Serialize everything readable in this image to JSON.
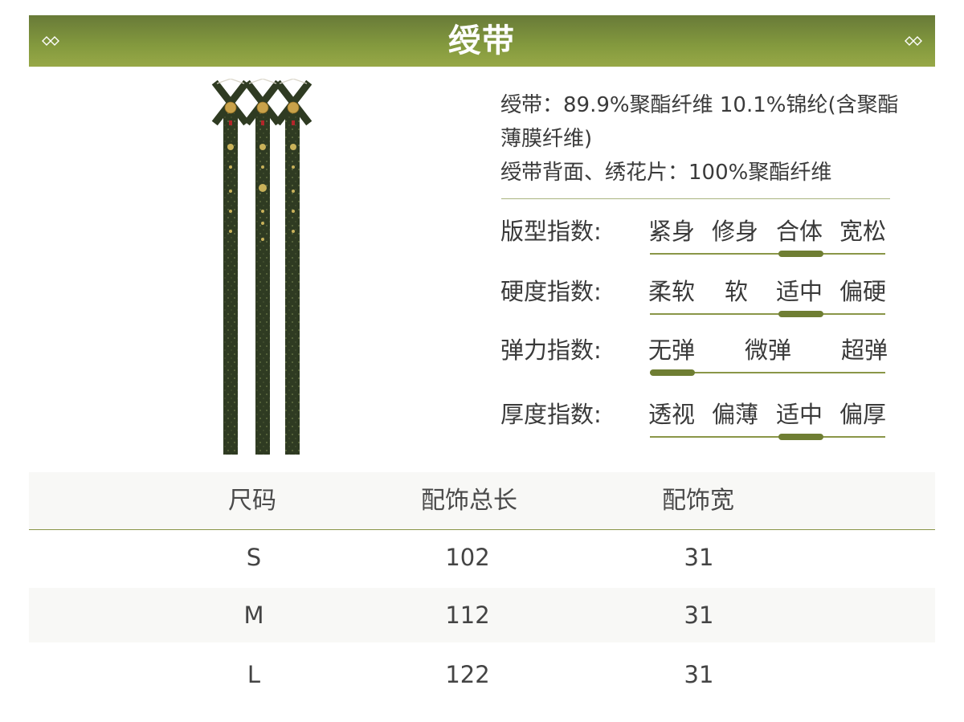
{
  "header": {
    "title": "绶带",
    "ornament_icon": "double-diamond-icon",
    "color": "#849a3e"
  },
  "product": {
    "image_icon": "ribbon-sash-illustration"
  },
  "material": {
    "lines": [
      "绶带：89.9%聚酯纤维 10.1%锦纶(含聚酯",
      "薄膜纤维)",
      "绶带背面、绣花片：100%聚酯纤维"
    ]
  },
  "indices": [
    {
      "label": "版型指数:",
      "options": [
        "紧身",
        "修身",
        "合体",
        "宽松"
      ],
      "selected": 2
    },
    {
      "label": "硬度指数:",
      "options": [
        "柔软",
        "软",
        "适中",
        "偏硬"
      ],
      "selected": 2
    },
    {
      "label": "弹力指数:",
      "options": [
        "无弹",
        "微弹",
        "超弹"
      ],
      "selected": 0
    },
    {
      "label": "厚度指数:",
      "options": [
        "透视",
        "偏薄",
        "适中",
        "偏厚"
      ],
      "selected": 2
    }
  ],
  "size_table": {
    "headers": [
      "尺码",
      "配饰总长",
      "配饰宽"
    ],
    "rows": [
      [
        "S",
        "102",
        "31"
      ],
      [
        "M",
        "112",
        "31"
      ],
      [
        "L",
        "122",
        "31"
      ]
    ]
  },
  "colors": {
    "accent": "#6f7e33",
    "track": "#8a9648",
    "ribbon": "#2f3b22"
  }
}
